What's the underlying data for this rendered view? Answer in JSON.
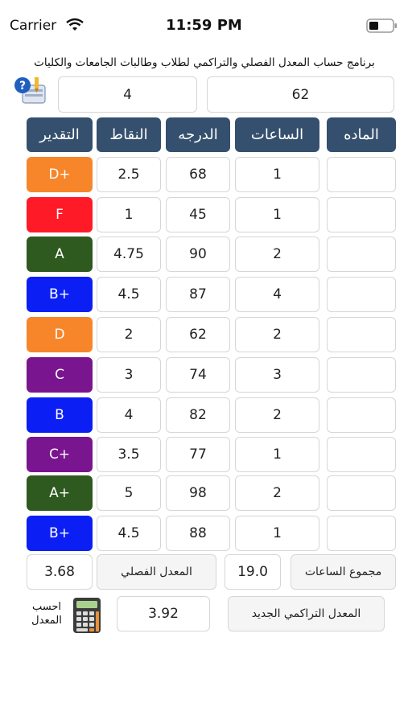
{
  "status_bar": {
    "carrier": "Carrier",
    "time": "11:59 PM"
  },
  "app": {
    "title": "برنامج حساب المعدل الفصلي والتراكمي لطلاب وطالبات الجامعات والكليات",
    "input_left": "4",
    "input_right": "62"
  },
  "headers": {
    "grade": "التقدير",
    "points": "النقاط",
    "score": "الدرجه",
    "hours": "الساعات",
    "subject": "الماده"
  },
  "rows": [
    {
      "grade": "D+",
      "color": "#f7862a",
      "points": "2.5",
      "score": "68",
      "hours": "1",
      "subject": ""
    },
    {
      "grade": "F",
      "color": "#ff1a27",
      "points": "1",
      "score": "45",
      "hours": "1",
      "subject": ""
    },
    {
      "grade": "A",
      "color": "#2f5a1f",
      "points": "4.75",
      "score": "90",
      "hours": "2",
      "subject": ""
    },
    {
      "grade": "B+",
      "color": "#0b1ff5",
      "points": "4.5",
      "score": "87",
      "hours": "4",
      "subject": ""
    },
    {
      "grade": "D",
      "color": "#f7862a",
      "points": "2",
      "score": "62",
      "hours": "2",
      "subject": ""
    },
    {
      "grade": "C",
      "color": "#7a1590",
      "points": "3",
      "score": "74",
      "hours": "3",
      "subject": ""
    },
    {
      "grade": "B",
      "color": "#0b1ff5",
      "points": "4",
      "score": "82",
      "hours": "2",
      "subject": ""
    },
    {
      "grade": "C+",
      "color": "#7a1590",
      "points": "3.5",
      "score": "77",
      "hours": "1",
      "subject": ""
    },
    {
      "grade": "A+",
      "color": "#2f5a1f",
      "points": "5",
      "score": "98",
      "hours": "2",
      "subject": ""
    },
    {
      "grade": "B+",
      "color": "#0b1ff5",
      "points": "4.5",
      "score": "88",
      "hours": "1",
      "subject": ""
    }
  ],
  "summary": {
    "semester_gpa_value": "3.68",
    "semester_gpa_label": "المعدل الفصلي",
    "total_hours_value": "19.0",
    "total_hours_label": "مجموع الساعات",
    "calc_label_line1": "احسب",
    "calc_label_line2": "المعدل",
    "cumulative_value": "3.92",
    "cumulative_label": "المعدل التراكمي الجديد"
  },
  "icons": {
    "help": "help-icon",
    "calculator": "calculator-icon",
    "wifi": "wifi-icon",
    "battery": "battery-icon"
  },
  "colors": {
    "header": "#35506e"
  }
}
